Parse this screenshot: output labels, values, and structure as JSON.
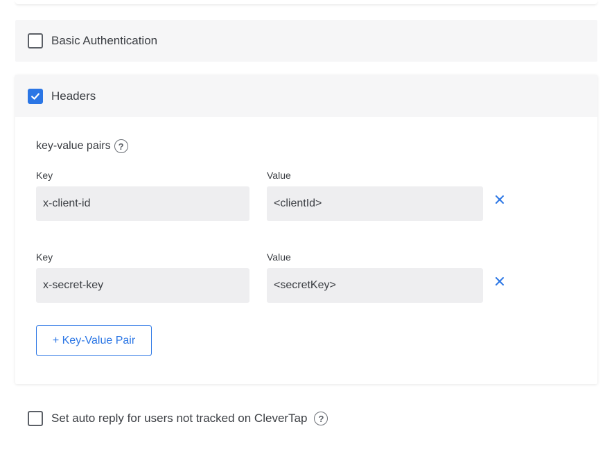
{
  "basic_auth": {
    "label": "Basic Authentication",
    "checked": false
  },
  "headers": {
    "label": "Headers",
    "checked": true,
    "kv_title": "key-value pairs",
    "pairs": [
      {
        "key_label": "Key",
        "value_label": "Value",
        "key": "x-client-id",
        "value": "<clientId>"
      },
      {
        "key_label": "Key",
        "value_label": "Value",
        "key": "x-secret-key",
        "value": "<secretKey>"
      }
    ],
    "add_button": "+ Key-Value Pair"
  },
  "auto_reply": {
    "label": "Set auto reply for users not tracked on CleverTap",
    "checked": false
  },
  "icons": {
    "help": "?",
    "remove": "close-icon",
    "check": "checkmark-icon"
  },
  "colors": {
    "accent": "#2b76e5",
    "panel": "#f6f6f7",
    "field": "#eeeef0",
    "text": "#3a3d42"
  }
}
